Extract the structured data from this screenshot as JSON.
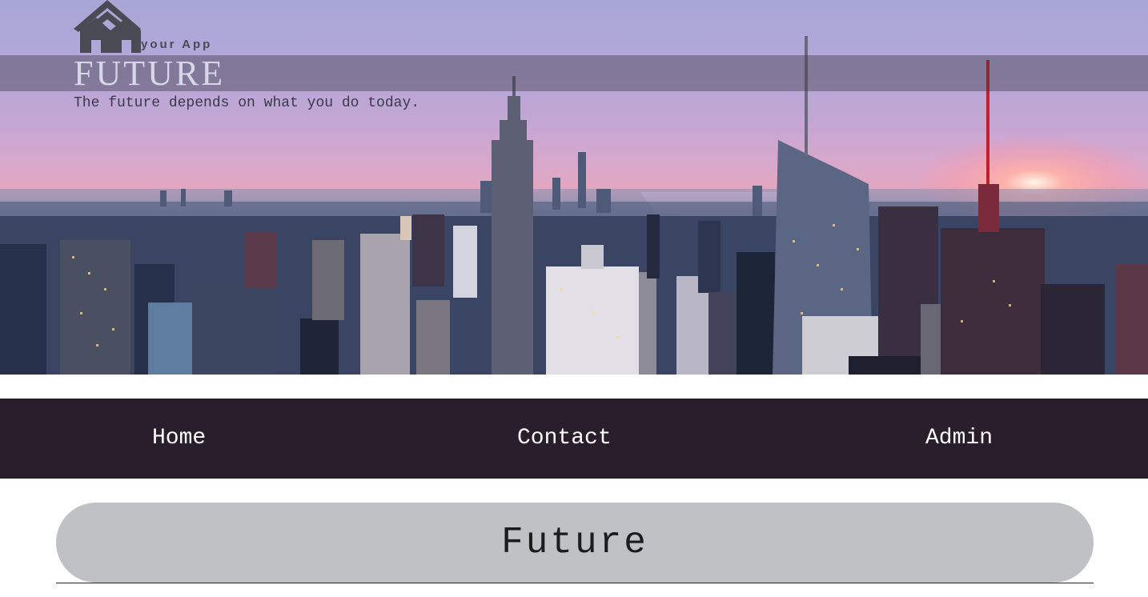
{
  "hero": {
    "logo_text": "your App",
    "brand_title": "FUTURE",
    "tagline": "The future depends on what you do today."
  },
  "nav": {
    "items": [
      {
        "label": "Home"
      },
      {
        "label": "Contact"
      },
      {
        "label": "Admin"
      }
    ],
    "background": "#281e2c"
  },
  "main": {
    "heading": "Future"
  },
  "colors": {
    "pill": "#c0c1c5",
    "nav_text": "#ffffff"
  }
}
